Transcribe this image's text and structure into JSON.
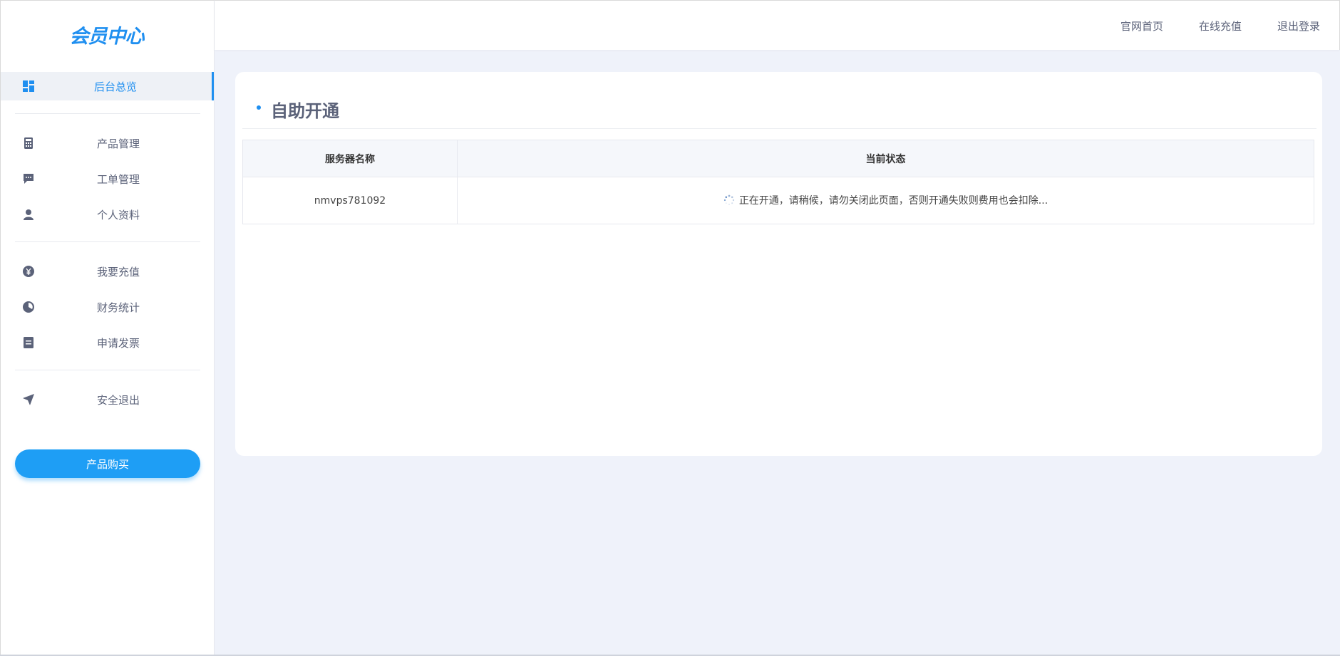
{
  "sidebar": {
    "logo": "会员中心",
    "items": [
      {
        "label": "后台总览",
        "icon": "dashboard-icon",
        "active": true
      },
      {
        "label": "产品管理",
        "icon": "calculator-icon",
        "active": false
      },
      {
        "label": "工单管理",
        "icon": "chat-icon",
        "active": false
      },
      {
        "label": "个人资料",
        "icon": "user-icon",
        "active": false
      },
      {
        "label": "我要充值",
        "icon": "yen-icon",
        "active": false
      },
      {
        "label": "财务统计",
        "icon": "pie-chart-icon",
        "active": false
      },
      {
        "label": "申请发票",
        "icon": "invoice-icon",
        "active": false
      },
      {
        "label": "安全退出",
        "icon": "navigation-arrow-icon",
        "active": false
      }
    ],
    "buy_button": "产品购买"
  },
  "header": {
    "links": [
      "官网首页",
      "在线充值",
      "退出登录"
    ]
  },
  "main": {
    "title": "自助开通",
    "table": {
      "headers": [
        "服务器名称",
        "当前状态"
      ],
      "rows": [
        {
          "name": "nmvps781092",
          "status": "正在开通，请稍候，请勿关闭此页面，否则开通失败则费用也会扣除..."
        }
      ]
    }
  },
  "colors": {
    "accent": "#1f8ff0",
    "button": "#1e9ef5",
    "nav_text": "#5b6279",
    "background": "#eff2fa"
  }
}
